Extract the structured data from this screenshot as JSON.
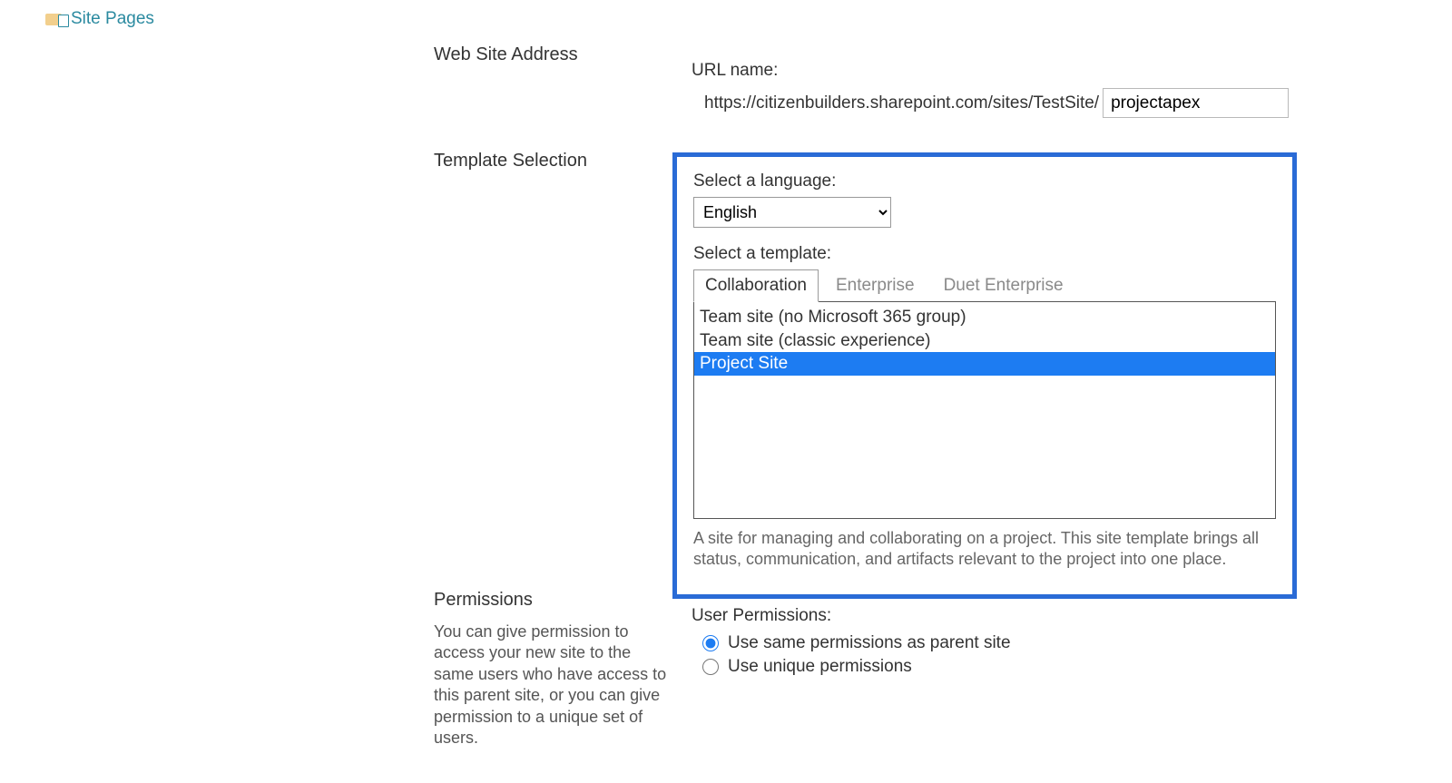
{
  "nav": {
    "site_pages": "Site Pages"
  },
  "website_address": {
    "heading": "Web Site Address",
    "url_name_label": "URL name:",
    "url_prefix": "https://citizenbuilders.sharepoint.com/sites/TestSite/",
    "url_value": "projectapex"
  },
  "template_selection": {
    "heading": "Template Selection",
    "language_label": "Select a language:",
    "language_selected": "English",
    "template_label": "Select a template:",
    "tabs": [
      {
        "label": "Collaboration",
        "active": true
      },
      {
        "label": "Enterprise",
        "active": false
      },
      {
        "label": "Duet Enterprise",
        "active": false
      }
    ],
    "templates": [
      {
        "label": "Team site (no Microsoft 365 group)",
        "selected": false
      },
      {
        "label": "Team site (classic experience)",
        "selected": false
      },
      {
        "label": "Project Site",
        "selected": true
      }
    ],
    "description": "A site for managing and collaborating on a project. This site template brings all status, communication, and artifacts relevant to the project into one place."
  },
  "permissions": {
    "heading": "Permissions",
    "help": "You can give permission to access your new site to the same users who have access to this parent site, or you can give permission to a unique set of users.",
    "user_permissions_label": "User Permissions:",
    "options": [
      {
        "label": "Use same permissions as parent site",
        "checked": true
      },
      {
        "label": "Use unique permissions",
        "checked": false
      }
    ]
  }
}
